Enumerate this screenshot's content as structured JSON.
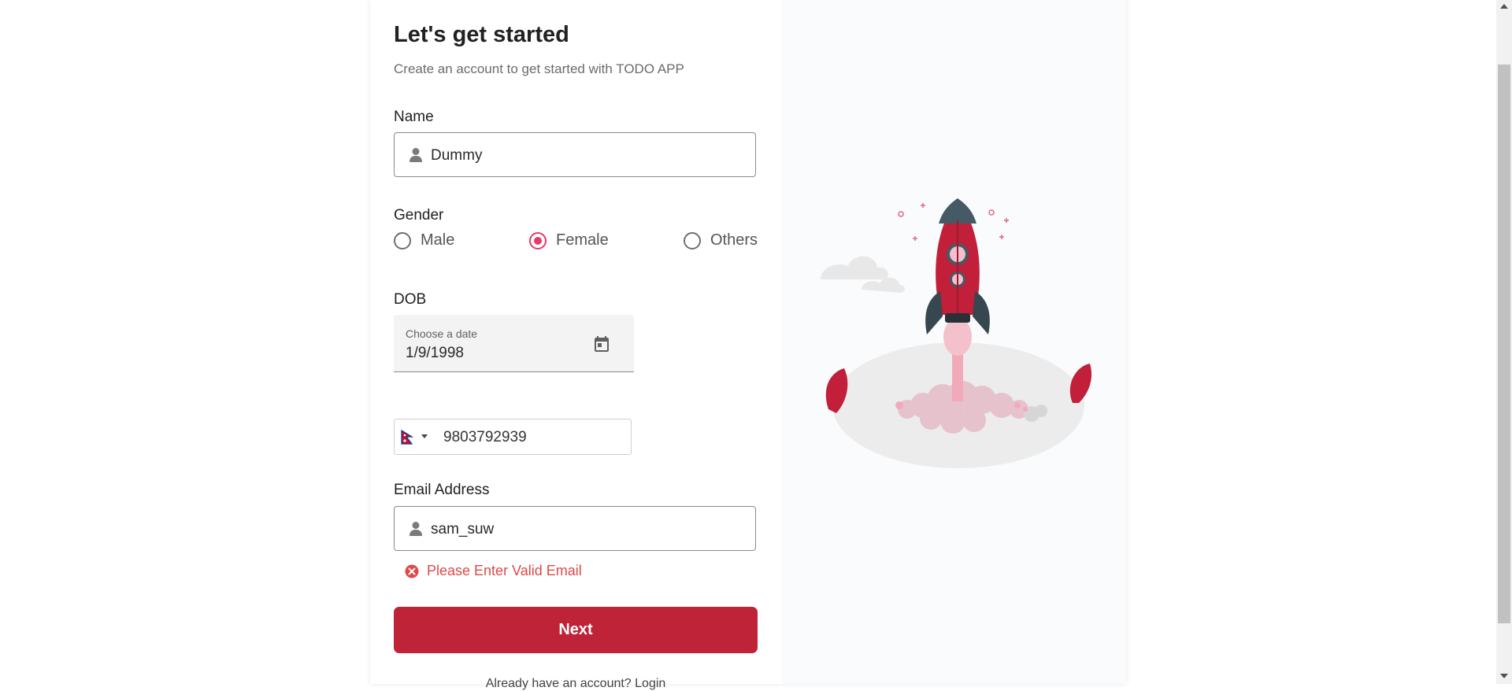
{
  "form": {
    "title": "Let's get started",
    "subtitle": "Create an account to get started with TODO APP",
    "name_label": "Name",
    "name_value": "Dummy",
    "gender_label": "Gender",
    "gender_options": [
      {
        "label": "Male",
        "selected": false
      },
      {
        "label": "Female",
        "selected": true
      },
      {
        "label": "Others",
        "selected": false
      }
    ],
    "dob_label": "DOB",
    "dob_placeholder": "Choose a date",
    "dob_value": "1/9/1998",
    "phone_value": "9803792939",
    "email_label": "Email Address",
    "email_value": "sam_suw",
    "email_error": "Please Enter Valid Email",
    "next_label": "Next",
    "bottom_text": "Already have an account? Login"
  },
  "icons": {
    "name_field_icon": "person-icon",
    "email_field_icon": "person-icon",
    "dob_icon": "calendar-icon",
    "phone_flag": "nepal-flag-icon",
    "error_icon": "error-circle-icon"
  },
  "colors": {
    "primary": "#be2338",
    "radio_accent": "#e53a6a",
    "error": "#e04848"
  }
}
